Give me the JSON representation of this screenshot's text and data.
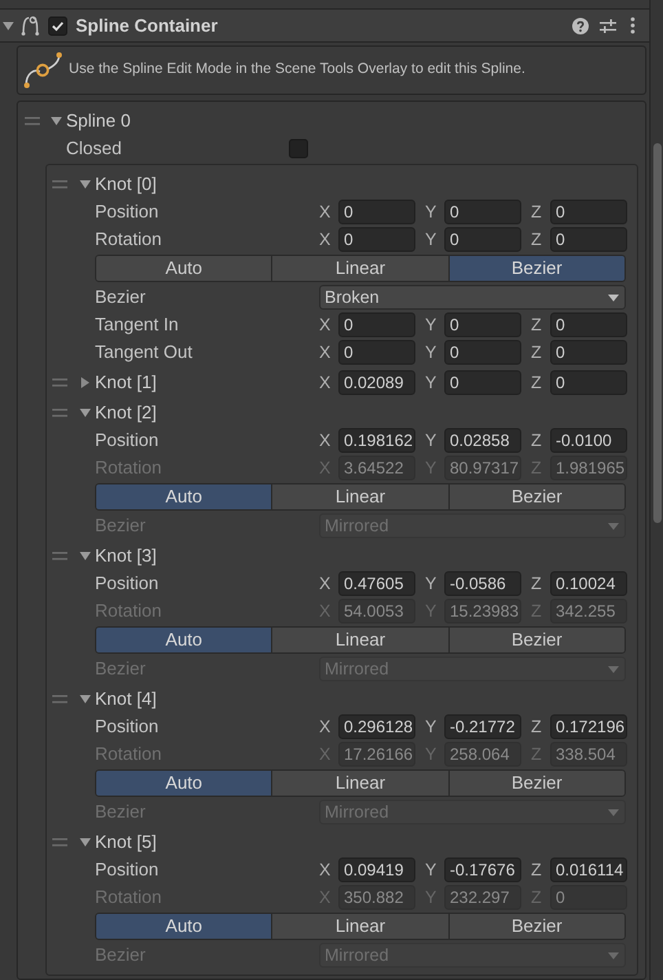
{
  "component": {
    "title": "Spline Container",
    "enabled": true,
    "expanded": true
  },
  "help_box": {
    "text": "Use the Spline Edit Mode in the Scene Tools Overlay to edit this Spline."
  },
  "spline": {
    "label": "Spline 0",
    "expanded": true,
    "closed": {
      "label": "Closed",
      "checked": false
    },
    "knots": [
      {
        "label": "Knot [0]",
        "expanded": true,
        "rows": [
          {
            "kind": "vector",
            "label": "Position",
            "disabled": false,
            "components": [
              {
                "axis": "X",
                "value": "0"
              },
              {
                "axis": "Y",
                "value": "0"
              },
              {
                "axis": "Z",
                "value": "0"
              }
            ]
          },
          {
            "kind": "vector",
            "label": "Rotation",
            "disabled": false,
            "components": [
              {
                "axis": "X",
                "value": "0"
              },
              {
                "axis": "Y",
                "value": "0"
              },
              {
                "axis": "Z",
                "value": "0"
              }
            ]
          },
          {
            "kind": "modes",
            "options": [
              {
                "label": "Auto",
                "selected": false
              },
              {
                "label": "Linear",
                "selected": false
              },
              {
                "label": "Bezier",
                "selected": true
              }
            ]
          },
          {
            "kind": "dropdown",
            "label": "Bezier",
            "value": "Broken",
            "disabled": false
          },
          {
            "kind": "vector",
            "label": "Tangent In",
            "disabled": false,
            "components": [
              {
                "axis": "X",
                "value": "0"
              },
              {
                "axis": "Y",
                "value": "0"
              },
              {
                "axis": "Z",
                "value": "0"
              }
            ]
          },
          {
            "kind": "vector",
            "label": "Tangent Out",
            "disabled": false,
            "components": [
              {
                "axis": "X",
                "value": "0"
              },
              {
                "axis": "Y",
                "value": "0"
              },
              {
                "axis": "Z",
                "value": "0"
              }
            ]
          }
        ]
      },
      {
        "label": "Knot [1]",
        "expanded": false,
        "components": [
          {
            "axis": "X",
            "value": "0.02089"
          },
          {
            "axis": "Y",
            "value": "0"
          },
          {
            "axis": "Z",
            "value": "0"
          }
        ]
      },
      {
        "label": "Knot [2]",
        "expanded": true,
        "rows": [
          {
            "kind": "vector",
            "label": "Position",
            "disabled": false,
            "components": [
              {
                "axis": "X",
                "value": "0.198162"
              },
              {
                "axis": "Y",
                "value": "0.02858"
              },
              {
                "axis": "Z",
                "value": "-0.0100"
              }
            ]
          },
          {
            "kind": "vector",
            "label": "Rotation",
            "disabled": true,
            "components": [
              {
                "axis": "X",
                "value": "3.64522"
              },
              {
                "axis": "Y",
                "value": "80.97317"
              },
              {
                "axis": "Z",
                "value": "1.981965"
              }
            ]
          },
          {
            "kind": "modes",
            "options": [
              {
                "label": "Auto",
                "selected": true
              },
              {
                "label": "Linear",
                "selected": false
              },
              {
                "label": "Bezier",
                "selected": false
              }
            ]
          },
          {
            "kind": "dropdown",
            "label": "Bezier",
            "value": "Mirrored",
            "disabled": true
          }
        ]
      },
      {
        "label": "Knot [3]",
        "expanded": true,
        "rows": [
          {
            "kind": "vector",
            "label": "Position",
            "disabled": false,
            "components": [
              {
                "axis": "X",
                "value": "0.47605"
              },
              {
                "axis": "Y",
                "value": "-0.0586"
              },
              {
                "axis": "Z",
                "value": "0.10024"
              }
            ]
          },
          {
            "kind": "vector",
            "label": "Rotation",
            "disabled": true,
            "components": [
              {
                "axis": "X",
                "value": "54.0053"
              },
              {
                "axis": "Y",
                "value": "15.23983"
              },
              {
                "axis": "Z",
                "value": "342.255"
              }
            ]
          },
          {
            "kind": "modes",
            "options": [
              {
                "label": "Auto",
                "selected": true
              },
              {
                "label": "Linear",
                "selected": false
              },
              {
                "label": "Bezier",
                "selected": false
              }
            ]
          },
          {
            "kind": "dropdown",
            "label": "Bezier",
            "value": "Mirrored",
            "disabled": true
          }
        ]
      },
      {
        "label": "Knot [4]",
        "expanded": true,
        "rows": [
          {
            "kind": "vector",
            "label": "Position",
            "disabled": false,
            "components": [
              {
                "axis": "X",
                "value": "0.296128"
              },
              {
                "axis": "Y",
                "value": "-0.21772"
              },
              {
                "axis": "Z",
                "value": "0.172196"
              }
            ]
          },
          {
            "kind": "vector",
            "label": "Rotation",
            "disabled": true,
            "components": [
              {
                "axis": "X",
                "value": "17.26166"
              },
              {
                "axis": "Y",
                "value": "258.064"
              },
              {
                "axis": "Z",
                "value": "338.504"
              }
            ]
          },
          {
            "kind": "modes",
            "options": [
              {
                "label": "Auto",
                "selected": true
              },
              {
                "label": "Linear",
                "selected": false
              },
              {
                "label": "Bezier",
                "selected": false
              }
            ]
          },
          {
            "kind": "dropdown",
            "label": "Bezier",
            "value": "Mirrored",
            "disabled": true
          }
        ]
      },
      {
        "label": "Knot [5]",
        "expanded": true,
        "rows": [
          {
            "kind": "vector",
            "label": "Position",
            "disabled": false,
            "components": [
              {
                "axis": "X",
                "value": "0.09419"
              },
              {
                "axis": "Y",
                "value": "-0.17676"
              },
              {
                "axis": "Z",
                "value": "0.016114"
              }
            ]
          },
          {
            "kind": "vector",
            "label": "Rotation",
            "disabled": true,
            "components": [
              {
                "axis": "X",
                "value": "350.882"
              },
              {
                "axis": "Y",
                "value": "232.297"
              },
              {
                "axis": "Z",
                "value": "0"
              }
            ]
          },
          {
            "kind": "modes",
            "options": [
              {
                "label": "Auto",
                "selected": true
              },
              {
                "label": "Linear",
                "selected": false
              },
              {
                "label": "Bezier",
                "selected": false
              }
            ]
          },
          {
            "kind": "dropdown",
            "label": "Bezier",
            "value": "Mirrored",
            "disabled": true
          }
        ]
      }
    ]
  }
}
